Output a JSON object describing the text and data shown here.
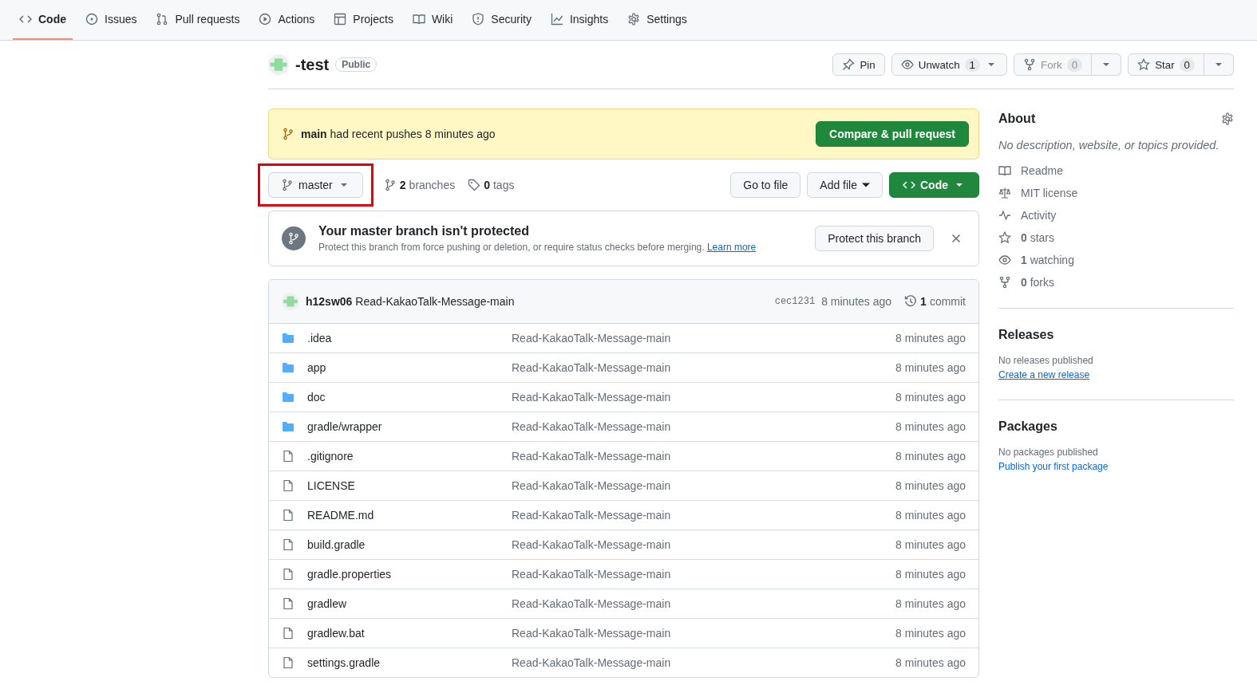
{
  "tabs": [
    {
      "label": "Code",
      "selected": true
    },
    {
      "label": "Issues",
      "selected": false
    },
    {
      "label": "Pull requests",
      "selected": false
    },
    {
      "label": "Actions",
      "selected": false
    },
    {
      "label": "Projects",
      "selected": false
    },
    {
      "label": "Wiki",
      "selected": false
    },
    {
      "label": "Security",
      "selected": false
    },
    {
      "label": "Insights",
      "selected": false
    },
    {
      "label": "Settings",
      "selected": false
    }
  ],
  "repo": {
    "name": "-test",
    "visibility": "Public"
  },
  "repo_actions": [
    {
      "label": "Pin",
      "kind": "plain",
      "disabled": false
    },
    {
      "label": "Unwatch",
      "count": "1",
      "kind": "dropdown",
      "disabled": false
    },
    {
      "label": "Fork",
      "count": "0",
      "kind": "split",
      "disabled": true
    },
    {
      "label": "Star",
      "count": "0",
      "kind": "split",
      "disabled": false
    }
  ],
  "push_banner": {
    "branch": "main",
    "text": "had recent pushes 8 minutes ago",
    "button": "Compare & pull request"
  },
  "branch_selector": {
    "label": "master",
    "highlighted": true
  },
  "branches": {
    "count": "2",
    "label": "branches"
  },
  "tags": {
    "count": "0",
    "label": "tags"
  },
  "toolbar_buttons": [
    {
      "label": "Go to file",
      "kind": "plain"
    },
    {
      "label": "Add file",
      "kind": "dropdown"
    },
    {
      "label": "Code",
      "kind": "primary"
    }
  ],
  "protect_notice": {
    "title": "Your master branch isn't protected",
    "text": "Protect this branch from force pushing or deletion, or require status checks before merging.",
    "link": "Learn more",
    "button": "Protect this branch"
  },
  "latest_commit": {
    "author": "h12sw06",
    "message": "Read-KakaoTalk-Message-main",
    "sha": "cec1231",
    "time": "8 minutes ago",
    "commits_count": "1",
    "commits_label": "commit"
  },
  "files": [
    {
      "name": ".idea",
      "kind": "folder",
      "message": "Read-KakaoTalk-Message-main",
      "time": "8 minutes ago"
    },
    {
      "name": "app",
      "kind": "folder",
      "message": "Read-KakaoTalk-Message-main",
      "time": "8 minutes ago"
    },
    {
      "name": "doc",
      "kind": "folder",
      "message": "Read-KakaoTalk-Message-main",
      "time": "8 minutes ago"
    },
    {
      "name": "gradle/wrapper",
      "kind": "folder",
      "message": "Read-KakaoTalk-Message-main",
      "time": "8 minutes ago"
    },
    {
      "name": ".gitignore",
      "kind": "file",
      "message": "Read-KakaoTalk-Message-main",
      "time": "8 minutes ago"
    },
    {
      "name": "LICENSE",
      "kind": "file",
      "message": "Read-KakaoTalk-Message-main",
      "time": "8 minutes ago"
    },
    {
      "name": "README.md",
      "kind": "file",
      "message": "Read-KakaoTalk-Message-main",
      "time": "8 minutes ago"
    },
    {
      "name": "build.gradle",
      "kind": "file",
      "message": "Read-KakaoTalk-Message-main",
      "time": "8 minutes ago"
    },
    {
      "name": "gradle.properties",
      "kind": "file",
      "message": "Read-KakaoTalk-Message-main",
      "time": "8 minutes ago"
    },
    {
      "name": "gradlew",
      "kind": "file",
      "message": "Read-KakaoTalk-Message-main",
      "time": "8 minutes ago"
    },
    {
      "name": "gradlew.bat",
      "kind": "file",
      "message": "Read-KakaoTalk-Message-main",
      "time": "8 minutes ago"
    },
    {
      "name": "settings.gradle",
      "kind": "file",
      "message": "Read-KakaoTalk-Message-main",
      "time": "8 minutes ago"
    }
  ],
  "about": {
    "title": "About",
    "description": "No description, website, or topics provided.",
    "items": [
      {
        "label": "Readme"
      },
      {
        "label": "MIT license"
      },
      {
        "label": "Activity"
      },
      {
        "count": "0",
        "label": "stars"
      },
      {
        "count": "1",
        "label": "watching"
      },
      {
        "count": "0",
        "label": "forks"
      }
    ]
  },
  "releases": {
    "title": "Releases",
    "text": "No releases published",
    "link": "Create a new release"
  },
  "packages": {
    "title": "Packages",
    "text": "No packages published",
    "link": "Publish your first package"
  }
}
